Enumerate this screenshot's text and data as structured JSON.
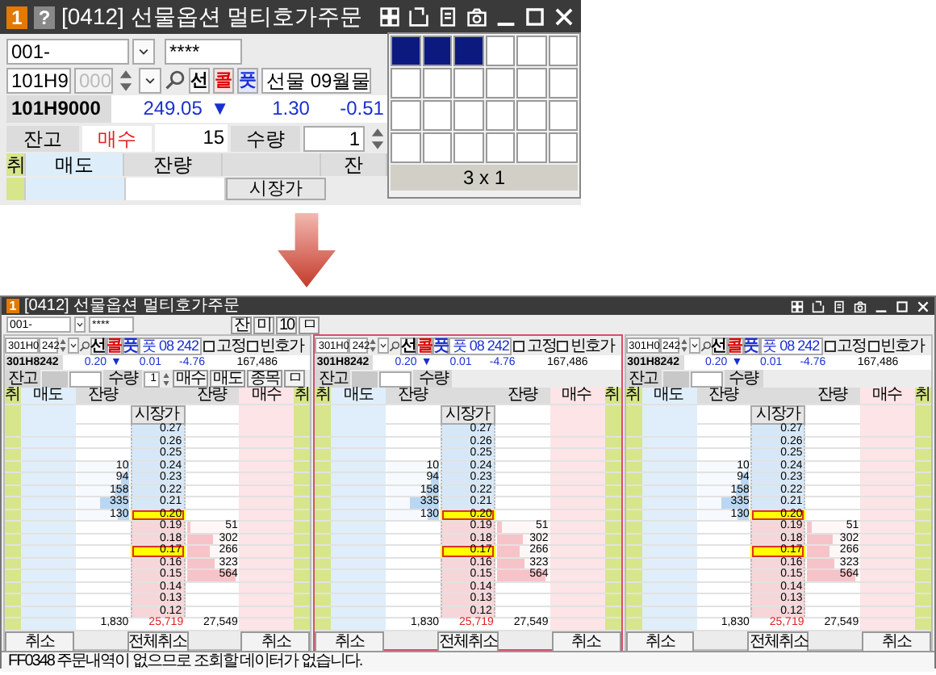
{
  "zoom_view": {
    "window": {
      "badge": "1",
      "help": "?",
      "title": "[0412] 선물옵션 멀티호가주문"
    },
    "account": {
      "number": "001-",
      "password": "****"
    },
    "code": {
      "value": "101H9",
      "suffix": "000",
      "month": "선물 09월물"
    },
    "types": [
      {
        "label": "선",
        "kind": "futures"
      },
      {
        "label": "콜",
        "kind": "call"
      },
      {
        "label": "풋",
        "kind": "put"
      }
    ],
    "quote": {
      "code": "101H9000",
      "price": "249.05",
      "direction": "▼",
      "change": "1.30",
      "rate": "-0.51"
    },
    "balance": {
      "label": "잔고",
      "side": {
        "label": "매수",
        "kind": "buy"
      },
      "quantity": "15",
      "qty_label": "수량",
      "qty_value": "1"
    },
    "columns": [
      {
        "label": "취",
        "kind": "cancel"
      },
      {
        "label": "매도",
        "kind": "ask"
      },
      {
        "label": "잔량",
        "kind": "qty"
      },
      {
        "kind": "price"
      },
      {
        "label": "잔",
        "kind": "qty"
      }
    ],
    "market_button": "시장가",
    "layout_picker": {
      "rows": [
        [
          {
            "selected": true
          },
          {
            "selected": true
          },
          {
            "selected": true
          },
          {
            "selected": false
          },
          {
            "selected": false
          },
          {
            "selected": false
          }
        ],
        [
          {
            "selected": false
          },
          {
            "selected": false
          },
          {
            "selected": false
          },
          {
            "selected": false
          },
          {
            "selected": false
          },
          {
            "selected": false
          }
        ],
        [
          {
            "selected": false
          },
          {
            "selected": false
          },
          {
            "selected": false
          },
          {
            "selected": false
          },
          {
            "selected": false
          },
          {
            "selected": false
          }
        ],
        [
          {
            "selected": false
          },
          {
            "selected": false
          },
          {
            "selected": false
          },
          {
            "selected": false
          },
          {
            "selected": false
          },
          {
            "selected": false
          }
        ]
      ],
      "caption": "3 x 1"
    }
  },
  "order_window": {
    "window": {
      "badge": "1",
      "title": "[0412] 선물옵션 멀티호가주문"
    },
    "account": {
      "number": "001-",
      "password": "****"
    },
    "tool_buttons": [
      "잔",
      "미",
      "10",
      "ㅁ"
    ],
    "panels": [
      {
        "selected": false,
        "code": "301H0",
        "series": "242",
        "types": [
          {
            "label": "선",
            "kind": "futures"
          },
          {
            "label": "콜",
            "kind": "call"
          },
          {
            "label": "풋",
            "kind": "put"
          }
        ],
        "month": "풋 08 242",
        "checkboxes": [
          {
            "label": "고정",
            "checked": false
          },
          {
            "label": "빈호가",
            "checked": false
          }
        ],
        "quote": {
          "code": "301H8242",
          "price": "0.20",
          "direction": "▼",
          "change": "0.01",
          "rate": "-4.76",
          "volume": "167,486"
        },
        "balance": {
          "label": "잔고",
          "qty_label": "수량",
          "qty_value": "1",
          "buttons": [
            "매수",
            "매도",
            "종목",
            "ㅁ"
          ]
        },
        "columns": [
          {
            "label": "취",
            "kind": "cancel"
          },
          {
            "label": "매도",
            "kind": "ask"
          },
          {
            "label": "잔량",
            "kind": "qty"
          },
          {
            "kind": "price"
          },
          {
            "label": "잔량",
            "kind": "qty"
          },
          {
            "label": "매수",
            "kind": "bid"
          },
          {
            "label": "취",
            "kind": "cancel"
          }
        ],
        "market_button": "시장가",
        "rows": [
          {
            "price": "0.27",
            "kind": "ask",
            "highlighted": false
          },
          {
            "price": "0.26",
            "kind": "ask",
            "highlighted": false
          },
          {
            "price": "0.25",
            "kind": "ask",
            "highlighted": false
          },
          {
            "price": "0.24",
            "kind": "ask",
            "highlighted": false,
            "quantity": "10",
            "level": 0.03
          },
          {
            "price": "0.23",
            "kind": "ask",
            "highlighted": false,
            "quantity": "94",
            "level": 0.16
          },
          {
            "price": "0.22",
            "kind": "ask",
            "highlighted": false,
            "quantity": "158",
            "level": 0.26
          },
          {
            "price": "0.21",
            "kind": "ask",
            "highlighted": false,
            "quantity": "335",
            "level": 0.56
          },
          {
            "price": "0.20",
            "kind": "ask",
            "highlighted": true,
            "quantity": "130",
            "level": 0.22
          },
          {
            "price": "0.19",
            "kind": "bid",
            "highlighted": false,
            "quantity": "51",
            "level": 0.09
          },
          {
            "price": "0.18",
            "kind": "bid",
            "highlighted": false,
            "quantity": "302",
            "level": 0.5
          },
          {
            "price": "0.17",
            "kind": "bid",
            "highlighted": true,
            "quantity": "266",
            "level": 0.44
          },
          {
            "price": "0.16",
            "kind": "bid",
            "highlighted": false,
            "quantity": "323",
            "level": 0.54
          },
          {
            "price": "0.15",
            "kind": "bid",
            "highlighted": false,
            "quantity": "564",
            "level": 0.94
          },
          {
            "price": "0.14",
            "kind": "bid",
            "highlighted": false
          },
          {
            "price": "0.13",
            "kind": "bid",
            "highlighted": false
          },
          {
            "price": "0.12",
            "kind": "bid",
            "highlighted": false
          }
        ],
        "totals": {
          "ask": "1,830",
          "net": "25,719",
          "bid": "27,549"
        },
        "buttons": [
          "취소",
          "전체취소",
          "취소"
        ]
      },
      {
        "selected": true,
        "code": "301H0",
        "series": "242",
        "types": [
          {
            "label": "선",
            "kind": "futures"
          },
          {
            "label": "콜",
            "kind": "call"
          },
          {
            "label": "풋",
            "kind": "put"
          }
        ],
        "month": "풋 08 242",
        "checkboxes": [
          {
            "label": "고정",
            "checked": false
          },
          {
            "label": "빈호가",
            "checked": false
          }
        ],
        "quote": {
          "code": "301H8242",
          "price": "0.20",
          "direction": "▼",
          "change": "0.01",
          "rate": "-4.76",
          "volume": "167,486"
        },
        "balance": {
          "label": "잔고",
          "qty_label": "수량"
        },
        "columns": [
          {
            "label": "취",
            "kind": "cancel"
          },
          {
            "label": "매도",
            "kind": "ask"
          },
          {
            "label": "잔량",
            "kind": "qty"
          },
          {
            "kind": "price"
          },
          {
            "label": "잔량",
            "kind": "qty"
          },
          {
            "label": "매수",
            "kind": "bid"
          },
          {
            "label": "취",
            "kind": "cancel"
          }
        ],
        "market_button": "시장가",
        "rows": [
          {
            "price": "0.27",
            "kind": "ask",
            "highlighted": false
          },
          {
            "price": "0.26",
            "kind": "ask",
            "highlighted": false
          },
          {
            "price": "0.25",
            "kind": "ask",
            "highlighted": false
          },
          {
            "price": "0.24",
            "kind": "ask",
            "highlighted": false,
            "quantity": "10",
            "level": 0.03
          },
          {
            "price": "0.23",
            "kind": "ask",
            "highlighted": false,
            "quantity": "94",
            "level": 0.16
          },
          {
            "price": "0.22",
            "kind": "ask",
            "highlighted": false,
            "quantity": "158",
            "level": 0.26
          },
          {
            "price": "0.21",
            "kind": "ask",
            "highlighted": false,
            "quantity": "335",
            "level": 0.56
          },
          {
            "price": "0.20",
            "kind": "ask",
            "highlighted": true,
            "quantity": "130",
            "level": 0.22
          },
          {
            "price": "0.19",
            "kind": "bid",
            "highlighted": false,
            "quantity": "51",
            "level": 0.09
          },
          {
            "price": "0.18",
            "kind": "bid",
            "highlighted": false,
            "quantity": "302",
            "level": 0.5
          },
          {
            "price": "0.17",
            "kind": "bid",
            "highlighted": true,
            "quantity": "266",
            "level": 0.44
          },
          {
            "price": "0.16",
            "kind": "bid",
            "highlighted": false,
            "quantity": "323",
            "level": 0.54
          },
          {
            "price": "0.15",
            "kind": "bid",
            "highlighted": false,
            "quantity": "564",
            "level": 0.94
          },
          {
            "price": "0.14",
            "kind": "bid",
            "highlighted": false
          },
          {
            "price": "0.13",
            "kind": "bid",
            "highlighted": false
          },
          {
            "price": "0.12",
            "kind": "bid",
            "highlighted": false
          }
        ],
        "totals": {
          "ask": "1,830",
          "net": "25,719",
          "bid": "27,549"
        },
        "buttons": [
          "취소",
          "전체취소",
          "취소"
        ]
      },
      {
        "selected": false,
        "code": "301H0",
        "series": "242",
        "types": [
          {
            "label": "선",
            "kind": "futures"
          },
          {
            "label": "콜",
            "kind": "call"
          },
          {
            "label": "풋",
            "kind": "put"
          }
        ],
        "month": "풋 08 242",
        "checkboxes": [
          {
            "label": "고정",
            "checked": false
          },
          {
            "label": "빈호가",
            "checked": false
          }
        ],
        "quote": {
          "code": "301H8242",
          "price": "0.20",
          "direction": "▼",
          "change": "0.01",
          "rate": "-4.76",
          "volume": "167,486"
        },
        "balance": {
          "label": "잔고",
          "qty_label": "수량"
        },
        "columns": [
          {
            "label": "취",
            "kind": "cancel"
          },
          {
            "label": "매도",
            "kind": "ask"
          },
          {
            "label": "잔량",
            "kind": "qty"
          },
          {
            "kind": "price"
          },
          {
            "label": "잔량",
            "kind": "qty"
          },
          {
            "label": "매수",
            "kind": "bid"
          },
          {
            "label": "취",
            "kind": "cancel"
          }
        ],
        "market_button": "시장가",
        "rows": [
          {
            "price": "0.27",
            "kind": "ask",
            "highlighted": false
          },
          {
            "price": "0.26",
            "kind": "ask",
            "highlighted": false
          },
          {
            "price": "0.25",
            "kind": "ask",
            "highlighted": false
          },
          {
            "price": "0.24",
            "kind": "ask",
            "highlighted": false,
            "quantity": "10",
            "level": 0.03
          },
          {
            "price": "0.23",
            "kind": "ask",
            "highlighted": false,
            "quantity": "94",
            "level": 0.16
          },
          {
            "price": "0.22",
            "kind": "ask",
            "highlighted": false,
            "quantity": "158",
            "level": 0.26
          },
          {
            "price": "0.21",
            "kind": "ask",
            "highlighted": false,
            "quantity": "335",
            "level": 0.56
          },
          {
            "price": "0.20",
            "kind": "ask",
            "highlighted": true,
            "quantity": "130",
            "level": 0.22
          },
          {
            "price": "0.19",
            "kind": "bid",
            "highlighted": false,
            "quantity": "51",
            "level": 0.09
          },
          {
            "price": "0.18",
            "kind": "bid",
            "highlighted": false,
            "quantity": "302",
            "level": 0.5
          },
          {
            "price": "0.17",
            "kind": "bid",
            "highlighted": true,
            "quantity": "266",
            "level": 0.44
          },
          {
            "price": "0.16",
            "kind": "bid",
            "highlighted": false,
            "quantity": "323",
            "level": 0.54
          },
          {
            "price": "0.15",
            "kind": "bid",
            "highlighted": false,
            "quantity": "564",
            "level": 0.94
          },
          {
            "price": "0.14",
            "kind": "bid",
            "highlighted": false
          },
          {
            "price": "0.13",
            "kind": "bid",
            "highlighted": false
          },
          {
            "price": "0.12",
            "kind": "bid",
            "highlighted": false
          }
        ],
        "totals": {
          "ask": "1,830",
          "net": "25,719",
          "bid": "27,549"
        },
        "buttons": [
          "취소",
          "전체취소",
          "취소"
        ]
      }
    ],
    "status_bar": "FF0348 주문내역이 없으므로 조회할 데이터가 없습니다."
  }
}
